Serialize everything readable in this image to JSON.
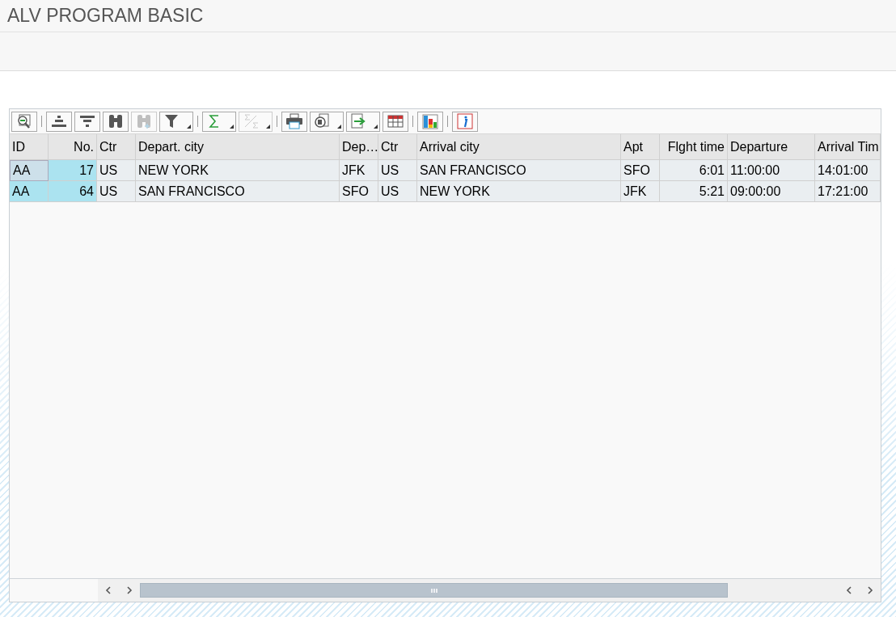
{
  "window": {
    "title": "ALV PROGRAM BASIC"
  },
  "toolbar": {
    "groups": [
      [
        {
          "kind": "details",
          "dropdown": false,
          "disabled": false
        }
      ],
      [
        {
          "kind": "sort-ascending",
          "dropdown": false,
          "disabled": false
        },
        {
          "kind": "sort-descending",
          "dropdown": false,
          "disabled": false
        },
        {
          "kind": "find",
          "dropdown": false,
          "disabled": false
        },
        {
          "kind": "find-next",
          "dropdown": false,
          "disabled": true
        },
        {
          "kind": "filter",
          "dropdown": true,
          "disabled": false
        }
      ],
      [
        {
          "kind": "sum",
          "dropdown": true,
          "disabled": false
        },
        {
          "kind": "subtotal",
          "dropdown": true,
          "disabled": true
        }
      ],
      [
        {
          "kind": "print",
          "dropdown": false,
          "disabled": false
        },
        {
          "kind": "views",
          "dropdown": true,
          "disabled": false
        },
        {
          "kind": "export",
          "dropdown": true,
          "disabled": false
        },
        {
          "kind": "layout",
          "dropdown": false,
          "disabled": false
        }
      ],
      [
        {
          "kind": "graphic",
          "dropdown": false,
          "disabled": false
        }
      ],
      [
        {
          "kind": "info",
          "dropdown": false,
          "disabled": false
        }
      ]
    ]
  },
  "table": {
    "columns": [
      {
        "label": "ID",
        "key": true,
        "kind": "text"
      },
      {
        "label": "No.",
        "key": true,
        "kind": "number"
      },
      {
        "label": "Ctr",
        "key": false,
        "kind": "text"
      },
      {
        "label": "Depart. city",
        "key": false,
        "kind": "text"
      },
      {
        "label": "Dep…",
        "key": false,
        "kind": "text"
      },
      {
        "label": "Ctr",
        "key": false,
        "kind": "text"
      },
      {
        "label": "Arrival city",
        "key": false,
        "kind": "text"
      },
      {
        "label": "Apt",
        "key": false,
        "kind": "text"
      },
      {
        "label": "Flght time",
        "key": false,
        "kind": "number"
      },
      {
        "label": "Departure",
        "key": false,
        "kind": "text"
      },
      {
        "label": "Arrival Tim",
        "key": false,
        "kind": "text"
      }
    ],
    "rows": [
      {
        "focused": true,
        "cells": [
          "AA",
          "17",
          "US",
          "NEW YORK",
          "JFK",
          "US",
          "SAN FRANCISCO",
          "SFO",
          "6:01",
          "11:00:00",
          "14:01:00"
        ]
      },
      {
        "focused": false,
        "cells": [
          "AA",
          "64",
          "US",
          "SAN FRANCISCO",
          "SFO",
          "US",
          "NEW YORK",
          "JFK",
          "5:21",
          "09:00:00",
          "17:21:00"
        ]
      }
    ]
  }
}
